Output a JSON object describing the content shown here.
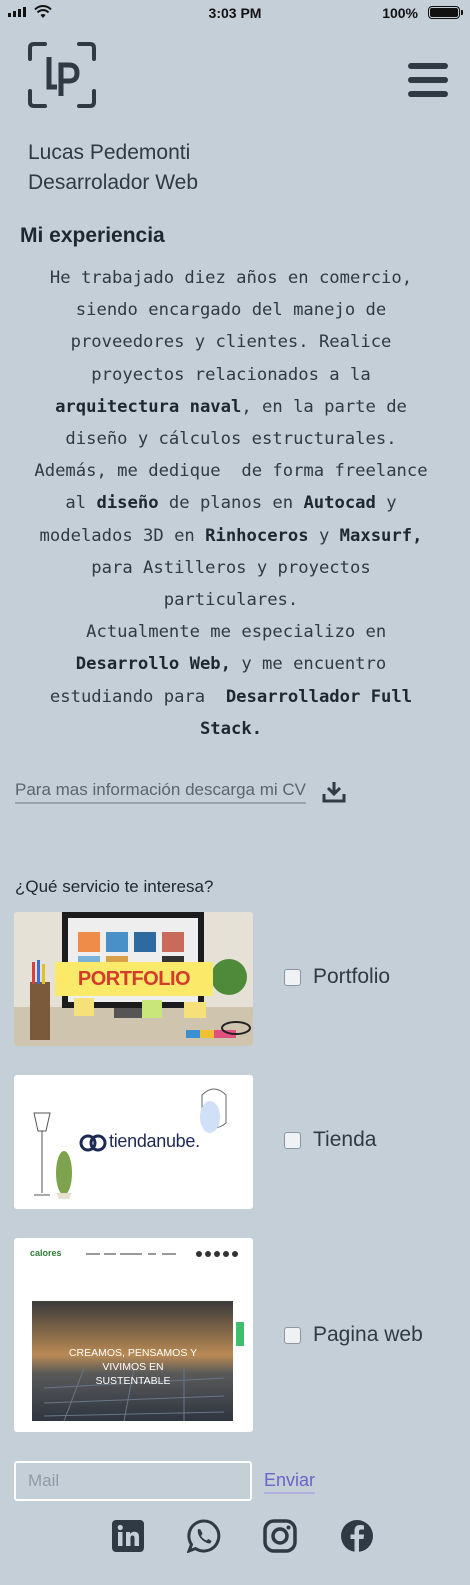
{
  "status_bar": {
    "time": "3:03 PM",
    "battery": "100%"
  },
  "header": {
    "logo_text": "LP"
  },
  "profile": {
    "name": "Lucas Pedemonti",
    "role": "Desarrolador Web"
  },
  "experience": {
    "title": "Mi experiencia",
    "lines": [
      [
        {
          "t": "He trabajado diez años en comercio,",
          "b": false
        }
      ],
      [
        {
          "t": "siendo encargado del manejo de",
          "b": false
        }
      ],
      [
        {
          "t": "proveedores y clientes. Realice",
          "b": false
        }
      ],
      [
        {
          "t": "proyectos relacionados a la",
          "b": false
        }
      ],
      [
        {
          "t": "arquitectura naval",
          "b": true
        },
        {
          "t": ", en la parte de",
          "b": false
        }
      ],
      [
        {
          "t": "diseño y cálculos estructurales.",
          "b": false
        }
      ],
      [
        {
          "t": "Además, me dedique  de forma freelance",
          "b": false
        }
      ],
      [
        {
          "t": "al ",
          "b": false
        },
        {
          "t": "diseño",
          "b": true
        },
        {
          "t": " de planos en ",
          "b": false
        },
        {
          "t": "Autocad",
          "b": true
        },
        {
          "t": " y",
          "b": false
        }
      ],
      [
        {
          "t": "modelados 3D en ",
          "b": false
        },
        {
          "t": "Rinhoceros",
          "b": true
        },
        {
          "t": " y ",
          "b": false
        },
        {
          "t": "Maxsurf,",
          "b": true
        }
      ],
      [
        {
          "t": "para Astilleros y proyectos",
          "b": false
        }
      ],
      [
        {
          "t": "particulares.",
          "b": false
        }
      ],
      [
        {
          "t": " Actualmente me especializo en",
          "b": false
        }
      ],
      [
        {
          "t": "Desarrollo Web,",
          "b": true
        },
        {
          "t": " y me encuentro",
          "b": false
        }
      ],
      [
        {
          "t": "estudiando para  ",
          "b": false
        },
        {
          "t": "Desarrollador Full",
          "b": true
        }
      ],
      [
        {
          "t": "Stack.",
          "b": true
        }
      ]
    ]
  },
  "cv": {
    "link_text": "Para mas información descarga mi CV"
  },
  "services": {
    "question": "¿Qué servicio te interesa?",
    "options": [
      {
        "label": "Portfolio",
        "image_text": "PORTFOLIO",
        "checked": false
      },
      {
        "label": "Tienda",
        "image_text": "tiendanube.",
        "checked": false
      },
      {
        "label": "Pagina web",
        "image_text": "CREAMOS, PENSAMOS Y VIVIMOS EN SUSTENTABLE",
        "brand": "calores",
        "checked": false
      }
    ]
  },
  "contact": {
    "mail_placeholder": "Mail",
    "send_label": "Enviar"
  },
  "social": [
    "linkedin-icon",
    "whatsapp-icon",
    "instagram-icon",
    "facebook-icon"
  ],
  "colors": {
    "background": "#c4cfd8",
    "text": "#2f3a44",
    "accent_link": "#6b63c9",
    "portfolio_banner": "#fbe96a"
  }
}
